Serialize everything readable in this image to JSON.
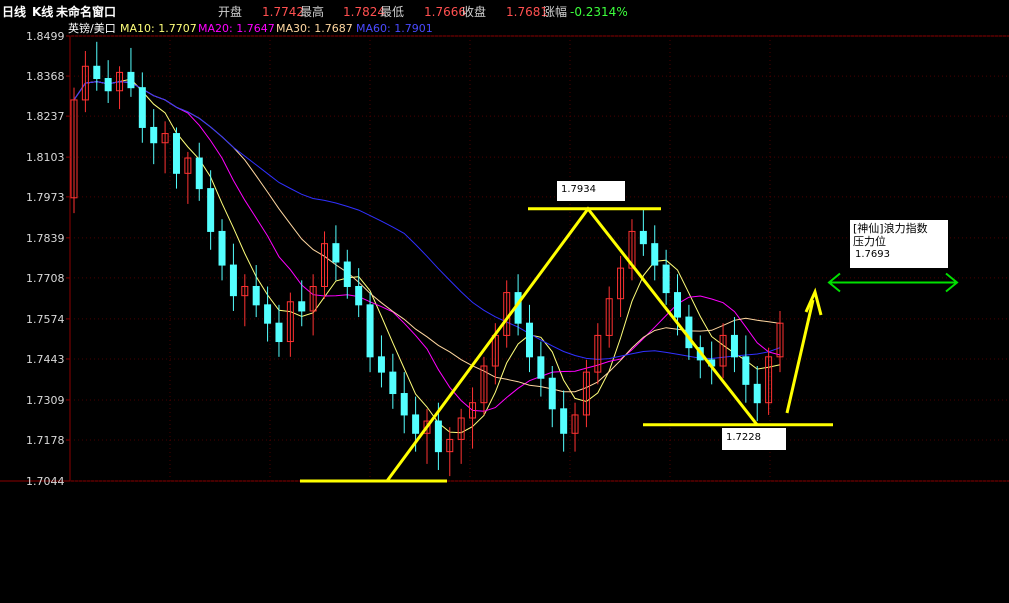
{
  "header": {
    "period": "日线",
    "chart_kind": "K线",
    "window_name": "未命名窗口",
    "open_label": "开盘",
    "open_value": "1.7742",
    "high_label": "最高",
    "high_value": "1.7824",
    "low_label": "最低",
    "low_value": "1.7666",
    "close_label": "收盘",
    "close_value": "1.7681",
    "change_label": "涨幅",
    "change_value": "-0.2314%"
  },
  "legend": {
    "symbol": "英镑/美口",
    "ma10": "MA10: 1.7707",
    "ma20": "MA20: 1.7647",
    "ma30": "MA30: 1.7687",
    "ma60": "MA60: 1.7901"
  },
  "colors": {
    "up": "#ff3232",
    "down": "#54ffff",
    "ma10": "#ffff7a",
    "ma20": "#ff00ff",
    "ma30": "#ffd7a0",
    "ma60": "#3030ff",
    "grid": "#8b0000",
    "annotation": "#ffff00",
    "resistance": "#00e000"
  },
  "annotations": {
    "peak_label": "1.7934",
    "trough_label": "1.7228",
    "resistance_title": "[神仙]浪力指数",
    "resistance_subtitle": "压力位",
    "resistance_value": "1.7693"
  },
  "chart_data": {
    "type": "candlestick",
    "title": "",
    "yticks": [
      "1.8499",
      "1.8368",
      "1.8237",
      "1.8103",
      "1.7973",
      "1.7839",
      "1.7708",
      "1.7574",
      "1.7443",
      "1.7309",
      "1.7178",
      "1.7044"
    ],
    "ylim": [
      1.7044,
      1.8499
    ],
    "grid": true,
    "key_levels": {
      "low": 1.7044,
      "peak": 1.7934,
      "trough": 1.7228,
      "resistance": 1.7693
    },
    "candles_ohlc": [
      [
        1.797,
        1.833,
        1.792,
        1.829
      ],
      [
        1.829,
        1.845,
        1.825,
        1.84
      ],
      [
        1.84,
        1.848,
        1.832,
        1.836
      ],
      [
        1.836,
        1.842,
        1.828,
        1.832
      ],
      [
        1.832,
        1.84,
        1.826,
        1.838
      ],
      [
        1.838,
        1.846,
        1.83,
        1.833
      ],
      [
        1.833,
        1.838,
        1.815,
        1.82
      ],
      [
        1.82,
        1.826,
        1.808,
        1.815
      ],
      [
        1.815,
        1.822,
        1.805,
        1.818
      ],
      [
        1.818,
        1.82,
        1.8,
        1.805
      ],
      [
        1.805,
        1.812,
        1.795,
        1.81
      ],
      [
        1.81,
        1.815,
        1.796,
        1.8
      ],
      [
        1.8,
        1.806,
        1.78,
        1.786
      ],
      [
        1.786,
        1.79,
        1.77,
        1.775
      ],
      [
        1.775,
        1.782,
        1.76,
        1.765
      ],
      [
        1.765,
        1.772,
        1.755,
        1.768
      ],
      [
        1.768,
        1.775,
        1.758,
        1.762
      ],
      [
        1.762,
        1.768,
        1.75,
        1.756
      ],
      [
        1.756,
        1.762,
        1.745,
        1.75
      ],
      [
        1.75,
        1.766,
        1.745,
        1.763
      ],
      [
        1.763,
        1.77,
        1.755,
        1.76
      ],
      [
        1.76,
        1.772,
        1.752,
        1.768
      ],
      [
        1.768,
        1.786,
        1.764,
        1.782
      ],
      [
        1.782,
        1.788,
        1.77,
        1.776
      ],
      [
        1.776,
        1.78,
        1.764,
        1.768
      ],
      [
        1.768,
        1.774,
        1.758,
        1.762
      ],
      [
        1.762,
        1.766,
        1.74,
        1.745
      ],
      [
        1.745,
        1.752,
        1.735,
        1.74
      ],
      [
        1.74,
        1.746,
        1.728,
        1.733
      ],
      [
        1.733,
        1.74,
        1.72,
        1.726
      ],
      [
        1.726,
        1.732,
        1.714,
        1.72
      ],
      [
        1.72,
        1.728,
        1.71,
        1.724
      ],
      [
        1.724,
        1.73,
        1.708,
        1.714
      ],
      [
        1.714,
        1.722,
        1.706,
        1.718
      ],
      [
        1.718,
        1.728,
        1.71,
        1.725
      ],
      [
        1.725,
        1.735,
        1.715,
        1.73
      ],
      [
        1.73,
        1.745,
        1.726,
        1.742
      ],
      [
        1.742,
        1.756,
        1.736,
        1.752
      ],
      [
        1.752,
        1.77,
        1.748,
        1.766
      ],
      [
        1.766,
        1.772,
        1.752,
        1.756
      ],
      [
        1.756,
        1.762,
        1.74,
        1.745
      ],
      [
        1.745,
        1.75,
        1.732,
        1.738
      ],
      [
        1.738,
        1.742,
        1.722,
        1.728
      ],
      [
        1.728,
        1.734,
        1.714,
        1.72
      ],
      [
        1.72,
        1.73,
        1.714,
        1.726
      ],
      [
        1.726,
        1.744,
        1.722,
        1.74
      ],
      [
        1.74,
        1.756,
        1.736,
        1.752
      ],
      [
        1.752,
        1.768,
        1.748,
        1.764
      ],
      [
        1.764,
        1.778,
        1.758,
        1.774
      ],
      [
        1.774,
        1.79,
        1.77,
        1.786
      ],
      [
        1.786,
        1.793,
        1.778,
        1.782
      ],
      [
        1.782,
        1.788,
        1.77,
        1.775
      ],
      [
        1.775,
        1.78,
        1.762,
        1.766
      ],
      [
        1.766,
        1.772,
        1.752,
        1.758
      ],
      [
        1.758,
        1.762,
        1.744,
        1.748
      ],
      [
        1.748,
        1.752,
        1.738,
        1.744
      ],
      [
        1.744,
        1.75,
        1.736,
        1.742
      ],
      [
        1.742,
        1.756,
        1.738,
        1.752
      ],
      [
        1.752,
        1.758,
        1.74,
        1.745
      ],
      [
        1.745,
        1.752,
        1.73,
        1.736
      ],
      [
        1.736,
        1.742,
        1.724,
        1.73
      ],
      [
        1.73,
        1.748,
        1.726,
        1.745
      ],
      [
        1.745,
        1.76,
        1.74,
        1.756
      ]
    ]
  }
}
